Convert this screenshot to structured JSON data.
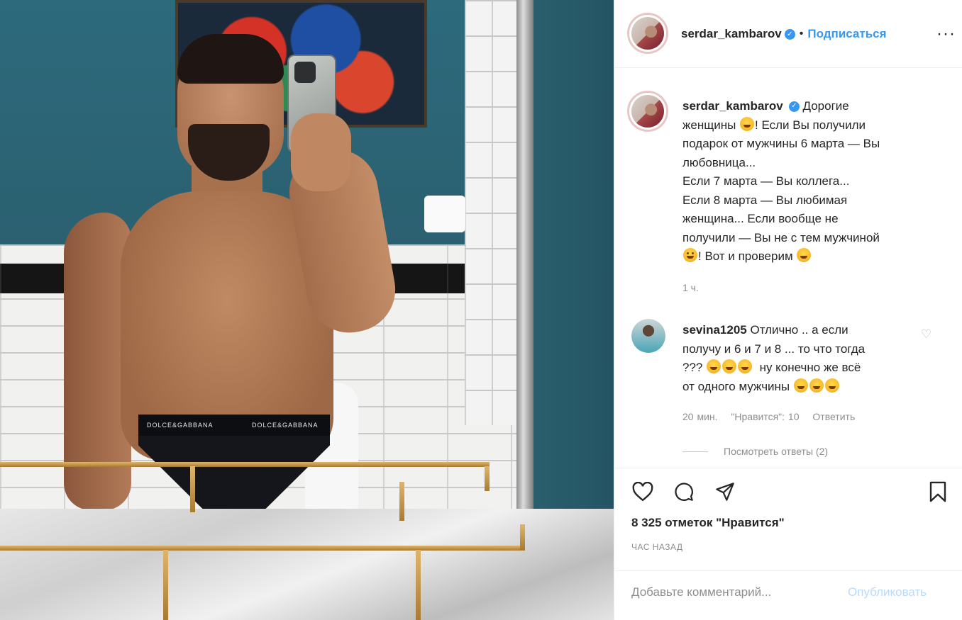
{
  "post": {
    "author": "serdar_kambarov",
    "follow_label": "Подписаться",
    "more_label": "···",
    "separator": "•"
  },
  "caption": {
    "username": "serdar_kambarov",
    "line1": "Дорогие",
    "line2_text": "женщины",
    "line2_after": "! Если Вы получили",
    "line3": "подарок от мужчины 6 марта — Вы",
    "line4": "любовница...",
    "line5": "Если 7 марта — Вы коллега...",
    "line6": "Если 8 марта — Вы любимая",
    "line7": "женщина... Если вообще не",
    "line8": "получили — Вы не с тем мужчиной",
    "line9_after": "! Вот и проверим",
    "time": "1 ч."
  },
  "comment": {
    "username": "sevina1205",
    "text1": "Отлично .. а если",
    "text2": "получу и 6 и 7 и 8 ... то что тогда",
    "text3_before": "???",
    "text3_after": "ну конечно же всё",
    "text4": "от одного мужчины",
    "time": "20 мин.",
    "likes": "\"Нравится\": 10",
    "reply": "Ответить",
    "view_replies": "Посмотреть ответы (2)"
  },
  "footer": {
    "likes": "8 325 отметок \"Нравится\"",
    "posted": "ЧАС НАЗАД",
    "comment_placeholder": "Добавьте комментарий...",
    "publish_label": "Опубликовать"
  },
  "photo": {
    "brand_text": "DOLCE&GABBANA"
  },
  "icons": {
    "like": "heart-icon",
    "comment": "comment-icon",
    "share": "share-icon",
    "save": "bookmark-icon",
    "verified": "verified-icon"
  },
  "colors": {
    "link": "#3897f0",
    "muted": "#8e8e8e",
    "text": "#262626"
  }
}
